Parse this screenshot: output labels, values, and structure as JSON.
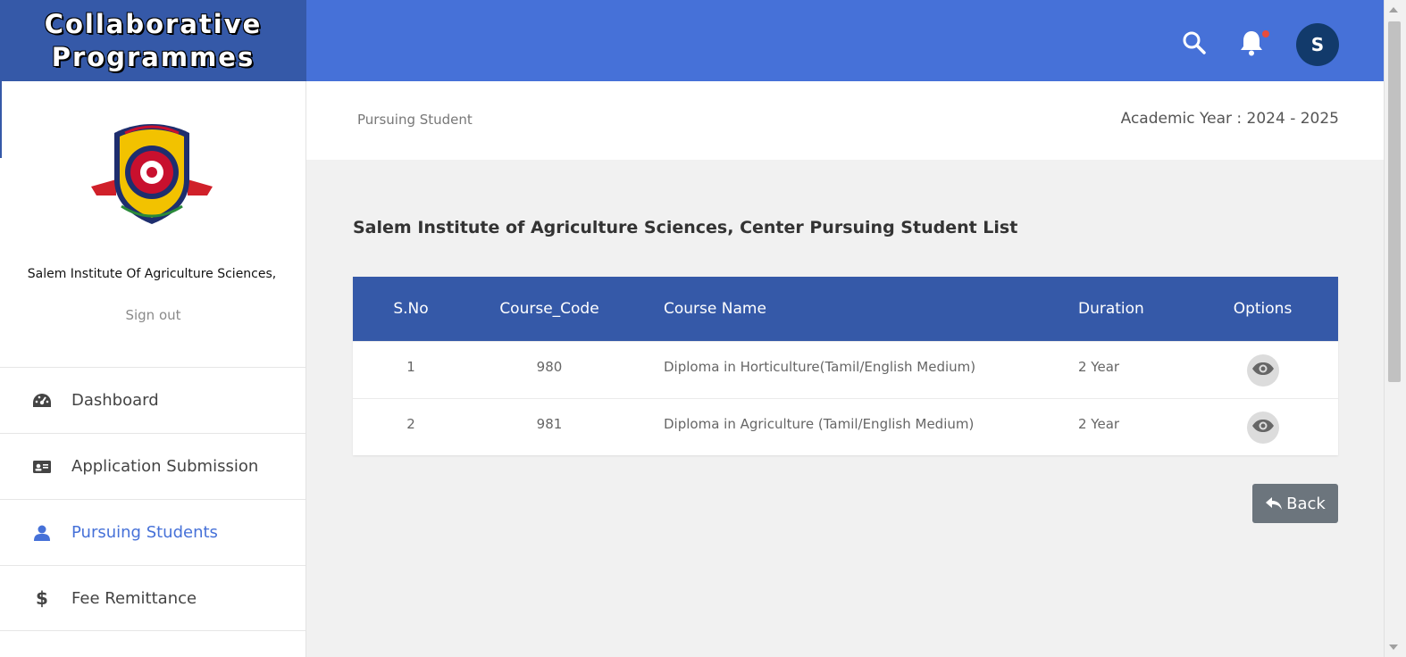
{
  "brand": {
    "line1": "Collaborative",
    "line2": "Programmes"
  },
  "header": {
    "avatar_initial": "S",
    "has_notification": true
  },
  "sidebar": {
    "institution_name": "Salem Institute Of Agriculture Sciences,",
    "signout_label": "Sign out",
    "items": [
      {
        "label": "Dashboard",
        "icon": "dashboard-icon"
      },
      {
        "label": "Application Submission",
        "icon": "id-card-icon"
      },
      {
        "label": "Pursuing Students",
        "icon": "user-icon",
        "active": true
      },
      {
        "label": "Fee Remittance",
        "icon": "dollar-icon"
      }
    ]
  },
  "breadcrumb": {
    "current": "Pursuing Student",
    "academic_year": "Academic Year : 2024 - 2025"
  },
  "main": {
    "heading": "Salem Institute of Agriculture Sciences, Center Pursuing Student List",
    "table": {
      "columns": [
        "S.No",
        "Course_Code",
        "Course Name",
        "Duration",
        "Options"
      ],
      "rows": [
        {
          "sno": "1",
          "code": "980",
          "name": "Diploma in Horticulture(Tamil/English Medium)",
          "duration": "2 Year"
        },
        {
          "sno": "2",
          "code": "981",
          "name": "Diploma in Agriculture (Tamil/English Medium)",
          "duration": "2 Year"
        }
      ]
    },
    "back_label": "Back"
  },
  "colors": {
    "header_blue": "#4671d8",
    "brand_blue": "#3559a8",
    "active_nav": "#4671d8",
    "back_button": "#6c757d"
  }
}
